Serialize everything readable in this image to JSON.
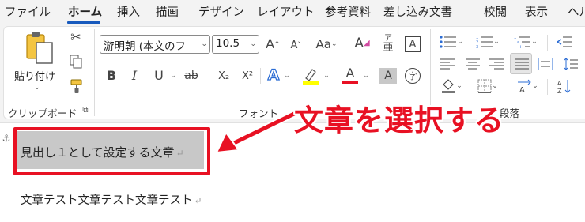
{
  "menu": {
    "tabs": [
      {
        "label": "ファイル"
      },
      {
        "label": "ホーム"
      },
      {
        "label": "挿入"
      },
      {
        "label": "描画"
      },
      {
        "label": "デザイン"
      },
      {
        "label": "レイアウト"
      },
      {
        "label": "参考資料"
      },
      {
        "label": "差し込み文書"
      },
      {
        "label": "校閲"
      },
      {
        "label": "表示"
      },
      {
        "label": "ヘル"
      }
    ],
    "active_tab": "ホーム"
  },
  "ribbon": {
    "clipboard": {
      "paste_label": "貼り付け",
      "group_label": "クリップボード"
    },
    "font": {
      "font_name": "游明朝 (本文のフ",
      "font_size": "10.5",
      "bold": "B",
      "italic": "I",
      "underline": "U",
      "strike": "ab",
      "subscript": "X₂",
      "superscript": "X²",
      "case": "Aa",
      "ruby_top": "ア",
      "ruby_bottom": "亜",
      "enclose": "A",
      "shade": "A",
      "circle": "字",
      "effects": "A",
      "font_color": "A",
      "group_label": "フォント"
    },
    "paragraph": {
      "group_label": "段落"
    }
  },
  "document": {
    "heading_text": "見出し１として設定する文章",
    "body_text": "文章テスト文章テスト文章テスト",
    "para_mark": "↵"
  },
  "annotation": {
    "text": "文章を選択する"
  },
  "colors": {
    "accent": "#185abd",
    "annotation_red": "#e81123",
    "highlight_yellow": "#ffff00",
    "font_red": "#e81123",
    "selection_gray": "#c8c8c8"
  }
}
